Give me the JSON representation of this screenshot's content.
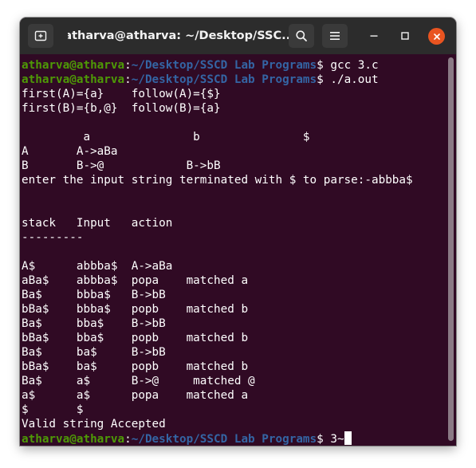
{
  "window": {
    "title": "atharva@atharva: ~/Desktop/SSC...",
    "accent_close": "#e95420",
    "terminal_bg": "#300a24"
  },
  "icons": {
    "new_tab": "new-tab-icon",
    "search": "search-icon",
    "menu": "hamburger-menu-icon",
    "minimize": "minimize-icon",
    "maximize": "maximize-icon",
    "close": "close-icon"
  },
  "terminal": {
    "prompt_user": "atharva@atharva",
    "prompt_sep": ":",
    "prompt_path": "~/Desktop/SSCD Lab Programs",
    "prompt_symbol": "$",
    "commands": [
      " gcc 3.c",
      " ./a.out",
      " 3~"
    ],
    "output": [
      "first(A)={a}    follow(A)={$}",
      "first(B)={b,@}  follow(B)={a}",
      "",
      "         a               b               $",
      "A       A->aBa",
      "B       B->@            B->bB",
      "enter the input string terminated with $ to parse:-abbba$",
      "",
      "",
      "stack   Input   action",
      "---------",
      "",
      "A$      abbba$  A->aBa",
      "aBa$    abbba$  popa    matched a",
      "Ba$     bbba$   B->bB",
      "bBa$    bbba$   popb    matched b",
      "Ba$     bba$    B->bB",
      "bBa$    bba$    popb    matched b",
      "Ba$     ba$     B->bB",
      "bBa$    ba$     popb    matched b",
      "Ba$     a$      B->@     matched @",
      "a$      a$      popa    matched a",
      "$       $",
      "Valid string Accepted"
    ]
  }
}
